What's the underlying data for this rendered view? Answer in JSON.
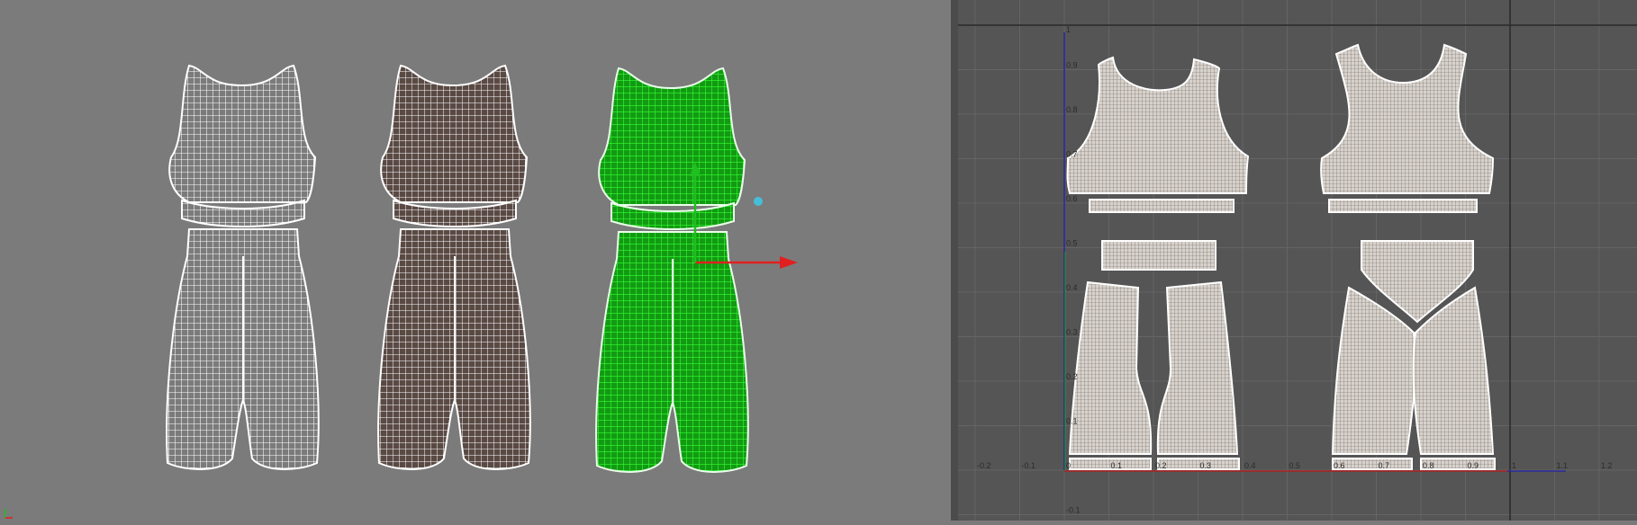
{
  "uv_editor": {
    "x_ticks": [
      "-0.2",
      "-0.1",
      "0",
      "0.1",
      "0.2",
      "0.3",
      "0.4",
      "0.5",
      "0.6",
      "0.7",
      "0.8",
      "0.9",
      "1",
      "1.1",
      "1.2"
    ],
    "y_ticks": [
      "1",
      "0.9",
      "0.8",
      "0.7",
      "0.6",
      "0.5",
      "0.4",
      "0.3",
      "0.2",
      "0.1",
      "-0.1"
    ]
  },
  "colors": {
    "viewport_bg": "#7b7b7b",
    "uv_bg": "#555555",
    "wire_white": "#ffffff",
    "wire_selected": "#22dd22",
    "uv_piece_fill": "#d8d2cc",
    "gizmo_x": "#e02020",
    "gizmo_y": "#20c020"
  },
  "icons": {
    "gizmo": "move-gizmo-icon",
    "axis_marker": "origin-axis-icon"
  }
}
